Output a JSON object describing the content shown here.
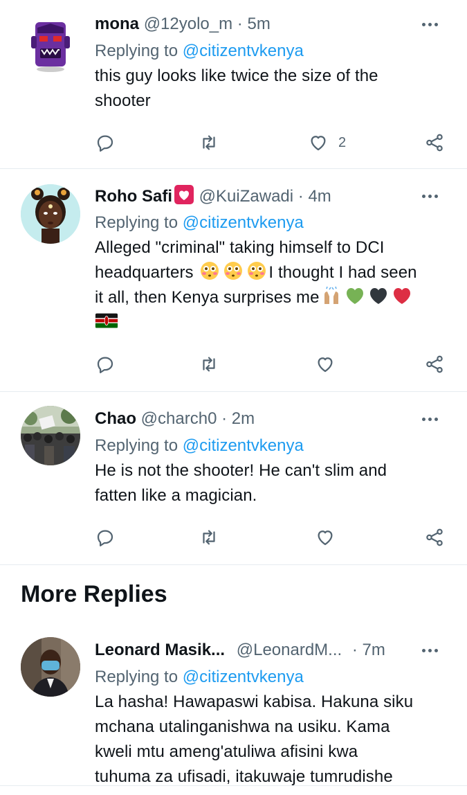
{
  "tweets": [
    {
      "name": "mona",
      "handle": "@12yolo_m",
      "separator": "·",
      "time": "5m",
      "replying_label": "Replying to",
      "replying_to": "@citizentvkenya",
      "text_lines": [
        "this guy looks like twice the size of the",
        "shooter"
      ],
      "like_count": "2"
    },
    {
      "name": "Roho Safi",
      "handle": "@KuiZawadi",
      "separator": "·",
      "time": "4m",
      "replying_label": "Replying to",
      "replying_to": "@citizentvkenya",
      "text_lines": [
        "Alleged \"criminal\" taking himself to DCI",
        "headquarters",
        "I thought I had seen",
        "it all, then Kenya surprises me"
      ],
      "like_count": ""
    },
    {
      "name": "Chao",
      "handle": "@charch0",
      "separator": "·",
      "time": "2m",
      "replying_label": "Replying to",
      "replying_to": "@citizentvkenya",
      "text_lines": [
        "He is not the shooter! He can't slim and",
        "fatten like a magician."
      ],
      "like_count": ""
    },
    {
      "name": "Leonard Masik...",
      "handle": "@LeonardM...",
      "separator": "·",
      "time": "7m",
      "replying_label": "Replying to",
      "replying_to": "@citizentvkenya",
      "text_lines": [
        "La hasha! Hawapaswi kabisa. Hakuna siku",
        "mchana utalinganishwa na usiku. Kama",
        "kweli mtu ameng'atuliwa afisini kwa",
        "tuhuma za ufisadi, itakuwaje tumrudishe"
      ],
      "like_count": ""
    }
  ],
  "section": {
    "more_replies": "More Replies"
  },
  "icons": {
    "reply": "comment-icon",
    "retweet": "retweet-icon",
    "like": "heart-icon",
    "share": "share-icon",
    "more": "more-dots-icon"
  },
  "colors": {
    "link": "#1d9bf0",
    "secondary": "#536471",
    "text": "#0f1419",
    "divider": "#e6ecf0"
  }
}
